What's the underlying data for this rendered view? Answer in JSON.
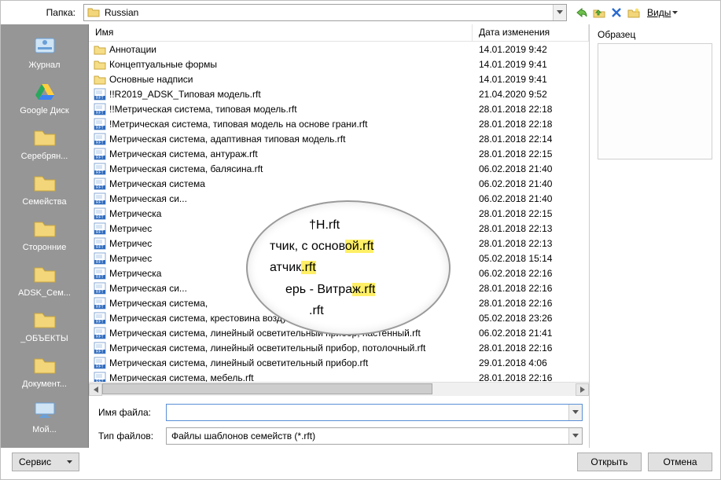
{
  "toprow": {
    "folder_label": "Папка:",
    "folder_value": "Russian",
    "views_label": "Виды"
  },
  "places": [
    {
      "label": "Журнал",
      "icon": "journal"
    },
    {
      "label": "Google Диск",
      "icon": "gdrive"
    },
    {
      "label": "Серебрян...",
      "icon": "folder"
    },
    {
      "label": "Семейства",
      "icon": "folder"
    },
    {
      "label": "Сторонние",
      "icon": "folder"
    },
    {
      "label": "ADSK_Сем...",
      "icon": "folder"
    },
    {
      "label": "_ОБЪЕКТЫ",
      "icon": "folder"
    },
    {
      "label": "Документ...",
      "icon": "folder"
    },
    {
      "label": "Мой...",
      "icon": "pc"
    }
  ],
  "columns": {
    "name": "Имя",
    "date": "Дата изменения"
  },
  "files": [
    {
      "kind": "folder",
      "name": "Аннотации",
      "date": "14.01.2019 9:42"
    },
    {
      "kind": "folder",
      "name": "Концептуальные формы",
      "date": "14.01.2019 9:41"
    },
    {
      "kind": "folder",
      "name": "Основные надписи",
      "date": "14.01.2019 9:41"
    },
    {
      "kind": "rft",
      "name": "!!R2019_ADSK_Типовая модель.rft",
      "date": "21.04.2020 9:52"
    },
    {
      "kind": "rft",
      "name": "!!Метрическая система, типовая модель.rft",
      "date": "28.01.2018 22:18"
    },
    {
      "kind": "rft",
      "name": "!Метрическая система, типовая модель на основе грани.rft",
      "date": "28.01.2018 22:18"
    },
    {
      "kind": "rft",
      "name": "Метрическая система, адаптивная типовая модель.rft",
      "date": "28.01.2018 22:14"
    },
    {
      "kind": "rft",
      "name": "Метрическая система, антураж.rft",
      "date": "28.01.2018 22:15"
    },
    {
      "kind": "rft",
      "name": "Метрическая система, балясина.rft",
      "date": "06.02.2018 21:40"
    },
    {
      "kind": "rft",
      "name": "Метрическая система",
      "date": "06.02.2018 21:40"
    },
    {
      "kind": "rft",
      "name": "Метрическая си...",
      "date": "06.02.2018 21:40"
    },
    {
      "kind": "rft",
      "name": "Метрическа",
      "date": "28.01.2018 22:15"
    },
    {
      "kind": "rft",
      "name": "Метричес",
      "date": "28.01.2018 22:13"
    },
    {
      "kind": "rft",
      "name": "Метричес",
      "date": "28.01.2018 22:13"
    },
    {
      "kind": "rft",
      "name": "Метричес",
      "date": "05.02.2018 15:14"
    },
    {
      "kind": "rft",
      "name": "Метрическа",
      "date": "06.02.2018 22:16"
    },
    {
      "kind": "rft",
      "name": "Метрическая си...",
      "date": "28.01.2018 22:16"
    },
    {
      "kind": "rft",
      "name": "Метрическая система,",
      "date": "28.01.2018 22:16"
    },
    {
      "kind": "rft",
      "name": "Метрическая система, крестовина воздуховода.rft",
      "date": "05.02.2018 23:26"
    },
    {
      "kind": "rft",
      "name": "Метрическая система, линейный осветительный прибор, настенный.rft",
      "date": "06.02.2018 21:41"
    },
    {
      "kind": "rft",
      "name": "Метрическая система, линейный осветительный прибор, потолочный.rft",
      "date": "28.01.2018 22:16"
    },
    {
      "kind": "rft",
      "name": "Метрическая система, линейный осветительный прибор.rft",
      "date": "29.01.2018 4:06"
    },
    {
      "kind": "rft",
      "name": "Метрическая система, мебель.rft",
      "date": "28.01.2018 22:16"
    }
  ],
  "lens": {
    "l1a": "†H.rft",
    "l2a": "тчик, с основ",
    "l2b": "ой.rft",
    "l3a": "атчик",
    "l3b": ".rft",
    "l4a": "ерь - Витра",
    "l4b": "ж.rft",
    "l5a": ".rft"
  },
  "preview_label": "Образец",
  "filename_label": "Имя файла:",
  "filename_value": "",
  "filetype_label": "Тип файлов:",
  "filetype_value": "Файлы шаблонов семейств  (*.rft)",
  "tools_label": "Сервис",
  "open_label": "Открыть",
  "cancel_label": "Отмена"
}
